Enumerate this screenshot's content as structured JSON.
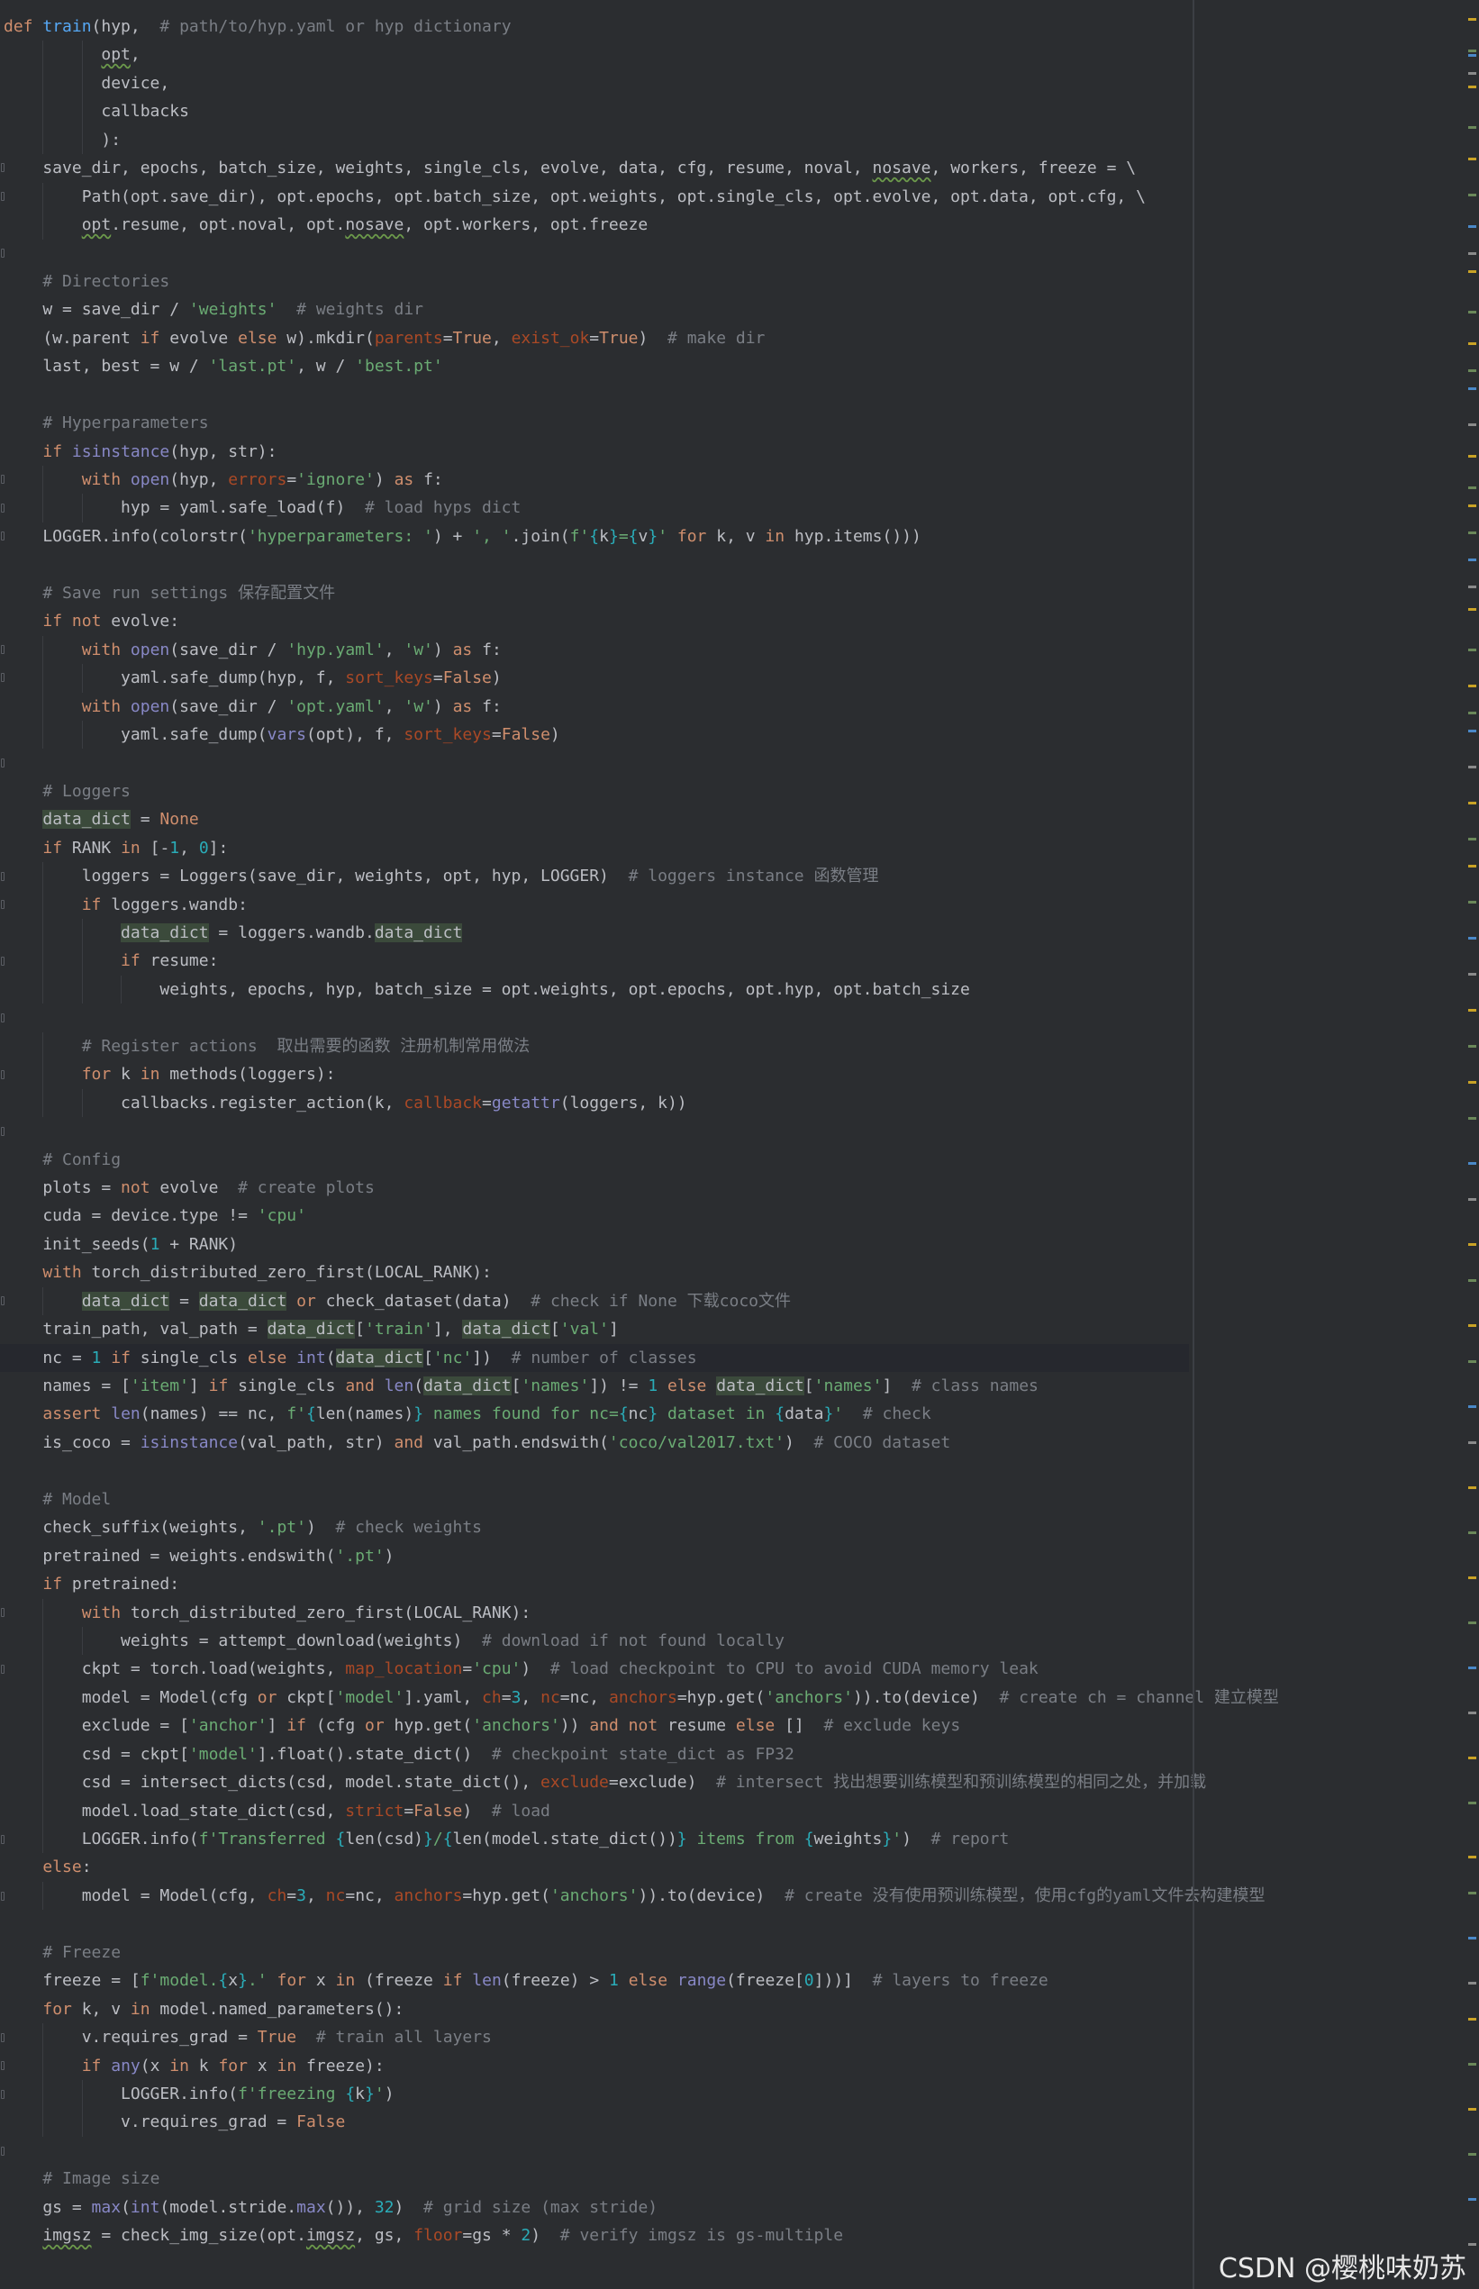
{
  "editor": {
    "language": "python",
    "function_name": "train",
    "colors": {
      "background": "#2b2d30",
      "keyword": "#cf8e6d",
      "function": "#56a8f5",
      "string": "#6aab73",
      "number": "#2aacb8",
      "comment": "#7a7e85",
      "param": "#aa4926",
      "builtin": "#8888c6",
      "default_text": "#bcbec4"
    },
    "lines": [
      "def train(hyp,  # path/to/hyp.yaml or hyp dictionary",
      "          opt,",
      "          device,",
      "          callbacks",
      "          ):",
      "    save_dir, epochs, batch_size, weights, single_cls, evolve, data, cfg, resume, noval, nosave, workers, freeze = \\",
      "        Path(opt.save_dir), opt.epochs, opt.batch_size, opt.weights, opt.single_cls, opt.evolve, opt.data, opt.cfg, \\",
      "        opt.resume, opt.noval, opt.nosave, opt.workers, opt.freeze",
      "",
      "    # Directories",
      "    w = save_dir / 'weights'  # weights dir",
      "    (w.parent if evolve else w).mkdir(parents=True, exist_ok=True)  # make dir",
      "    last, best = w / 'last.pt', w / 'best.pt'",
      "",
      "    # Hyperparameters",
      "    if isinstance(hyp, str):",
      "        with open(hyp, errors='ignore') as f:",
      "            hyp = yaml.safe_load(f)  # load hyps dict",
      "    LOGGER.info(colorstr('hyperparameters: ') + ', '.join(f'{k}={v}' for k, v in hyp.items()))",
      "",
      "    # Save run settings 保存配置文件",
      "    if not evolve:",
      "        with open(save_dir / 'hyp.yaml', 'w') as f:",
      "            yaml.safe_dump(hyp, f, sort_keys=False)",
      "        with open(save_dir / 'opt.yaml', 'w') as f:",
      "            yaml.safe_dump(vars(opt), f, sort_keys=False)",
      "",
      "    # Loggers",
      "    data_dict = None",
      "    if RANK in [-1, 0]:",
      "        loggers = Loggers(save_dir, weights, opt, hyp, LOGGER)  # loggers instance 函数管理",
      "        if loggers.wandb:",
      "            data_dict = loggers.wandb.data_dict",
      "            if resume:",
      "                weights, epochs, hyp, batch_size = opt.weights, opt.epochs, opt.hyp, opt.batch_size",
      "",
      "        # Register actions  取出需要的函数 注册机制常用做法",
      "        for k in methods(loggers):",
      "            callbacks.register_action(k, callback=getattr(loggers, k))",
      "",
      "    # Config",
      "    plots = not evolve  # create plots",
      "    cuda = device.type != 'cpu'",
      "    init_seeds(1 + RANK)",
      "    with torch_distributed_zero_first(LOCAL_RANK):",
      "        data_dict = data_dict or check_dataset(data)  # check if None 下载coco文件",
      "    train_path, val_path = data_dict['train'], data_dict['val']",
      "    nc = 1 if single_cls else int(data_dict['nc'])  # number of classes",
      "    names = ['item'] if single_cls and len(data_dict['names']) != 1 else data_dict['names']  # class names",
      "    assert len(names) == nc, f'{len(names)} names found for nc={nc} dataset in {data}'  # check",
      "    is_coco = isinstance(val_path, str) and val_path.endswith('coco/val2017.txt')  # COCO dataset",
      "",
      "    # Model",
      "    check_suffix(weights, '.pt')  # check weights",
      "    pretrained = weights.endswith('.pt')",
      "    if pretrained:",
      "        with torch_distributed_zero_first(LOCAL_RANK):",
      "            weights = attempt_download(weights)  # download if not found locally",
      "        ckpt = torch.load(weights, map_location='cpu')  # load checkpoint to CPU to avoid CUDA memory leak",
      "        model = Model(cfg or ckpt['model'].yaml, ch=3, nc=nc, anchors=hyp.get('anchors')).to(device)  # create ch = channel 建立模型",
      "        exclude = ['anchor'] if (cfg or hyp.get('anchors')) and not resume else []  # exclude keys",
      "        csd = ckpt['model'].float().state_dict()  # checkpoint state_dict as FP32",
      "        csd = intersect_dicts(csd, model.state_dict(), exclude=exclude)  # intersect 找出想要训练模型和预训练模型的相同之处，并加载",
      "        model.load_state_dict(csd, strict=False)  # load",
      "        LOGGER.info(f'Transferred {len(csd)}/{len(model.state_dict())} items from {weights}')  # report",
      "    else:",
      "        model = Model(cfg, ch=3, nc=nc, anchors=hyp.get('anchors')).to(device)  # create 没有使用预训练模型，使用cfg的yaml文件去构建模型",
      "",
      "    # Freeze",
      "    freeze = [f'model.{x}.' for x in (freeze if len(freeze) > 1 else range(freeze[0]))]  # layers to freeze",
      "    for k, v in model.named_parameters():",
      "        v.requires_grad = True  # train all layers",
      "        if any(x in k for x in freeze):",
      "            LOGGER.info(f'freezing {k}')",
      "            v.requires_grad = False",
      "",
      "    # Image size",
      "    gs = max(int(model.stride.max()), 32)  # grid size (max stride)",
      "    imgsz = check_img_size(opt.imgsz, gs, floor=gs * 2)  # verify imgsz is gs-multiple"
    ],
    "current_line": 47,
    "fold_lines": [
      5,
      6,
      8,
      16,
      17,
      18,
      22,
      23,
      26,
      30,
      31,
      33,
      35,
      37,
      39,
      45,
      56,
      58,
      64,
      66,
      71,
      72,
      73,
      75
    ]
  },
  "watermark": {
    "text": "CSDN @樱桃味奶苏"
  }
}
